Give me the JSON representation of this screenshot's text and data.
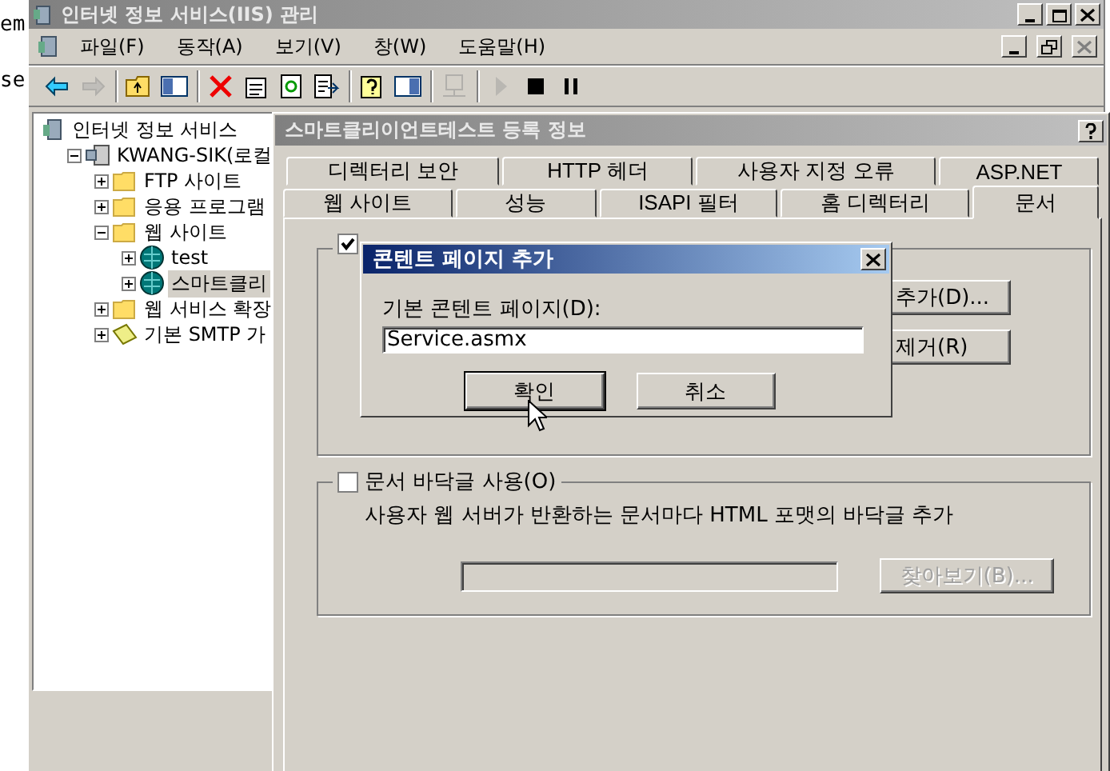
{
  "desktop": {
    "texts": [
      "em",
      "se"
    ]
  },
  "window": {
    "title": "인터넷 정보 서비스(IIS) 관리"
  },
  "menu": [
    "파일(F)",
    "동작(A)",
    "보기(V)",
    "창(W)",
    "도움말(H)"
  ],
  "toolbar": [
    [
      {
        "kind": "back",
        "disabled": false
      },
      {
        "kind": "forward",
        "disabled": true
      }
    ],
    [
      {
        "kind": "up",
        "disabled": false
      },
      {
        "kind": "tree",
        "disabled": false
      }
    ],
    [
      {
        "kind": "delete",
        "disabled": false
      },
      {
        "kind": "properties",
        "disabled": false
      },
      {
        "kind": "refresh",
        "disabled": false
      },
      {
        "kind": "export",
        "disabled": false
      }
    ],
    [
      {
        "kind": "help",
        "disabled": false
      },
      {
        "kind": "pane",
        "disabled": false
      }
    ],
    [
      {
        "kind": "computer",
        "disabled": true
      }
    ],
    [
      {
        "kind": "play",
        "disabled": true
      },
      {
        "kind": "stop",
        "disabled": false
      },
      {
        "kind": "pause",
        "disabled": false
      }
    ]
  ],
  "tree": [
    {
      "label": "인터넷 정보 서비스",
      "kind": "root",
      "selected": false,
      "children": [
        {
          "label": "KWANG-SIK(로컬",
          "kind": "server",
          "expanded": true,
          "selected": false,
          "children": [
            {
              "label": "FTP 사이트",
              "kind": "folder",
              "expanded": false,
              "selected": false
            },
            {
              "label": "응용 프로그램",
              "kind": "folder",
              "expanded": false,
              "selected": false
            },
            {
              "label": "웹 사이트",
              "kind": "folder",
              "expanded": true,
              "selected": false,
              "children": [
                {
                  "label": "test",
                  "kind": "globe",
                  "expanded": false,
                  "selected": false
                },
                {
                  "label": "스마트클리",
                  "kind": "globe",
                  "expanded": false,
                  "selected": true
                }
              ]
            },
            {
              "label": "웹 서비스 확장",
              "kind": "folder",
              "expanded": false,
              "selected": false
            },
            {
              "label": "기본 SMTP 가",
              "kind": "mail",
              "expanded": false,
              "selected": false
            }
          ]
        }
      ]
    }
  ],
  "properties": {
    "title": "스마트클리이언트테스트 등록 정보",
    "tabs_back": [
      {
        "label": "디렉터리 보안",
        "selected": false
      },
      {
        "label": "HTTP 헤더",
        "selected": false
      },
      {
        "label": "사용자 지정 오류",
        "selected": false
      },
      {
        "label": "ASP.NET",
        "selected": false
      }
    ],
    "tabs_front": [
      {
        "label": "웹 사이트",
        "selected": false
      },
      {
        "label": "성능",
        "selected": false
      },
      {
        "label": "ISAPI 필터",
        "selected": false
      },
      {
        "label": "홈 디렉터리",
        "selected": false
      },
      {
        "label": "문서",
        "selected": true
      }
    ],
    "default_page": {
      "checked": true,
      "buttons": [
        "추가(D)...",
        "제거(R)"
      ]
    },
    "footer": {
      "label": "문서 바닥글 사용(O)",
      "checked": false,
      "description": "사용자 웹 서버가 반환하는 문서마다 HTML 포맷의 바닥글 추가",
      "browse": {
        "label": "찾아보기(B)...",
        "disabled": true
      }
    }
  },
  "add_dialog": {
    "title": "콘텐트 페이지 추가",
    "field_label": "기본 콘텐트 페이지(D):",
    "value": "Service.asmx",
    "buttons": [
      {
        "label": "확인",
        "default": true
      },
      {
        "label": "취소",
        "default": false
      }
    ]
  }
}
